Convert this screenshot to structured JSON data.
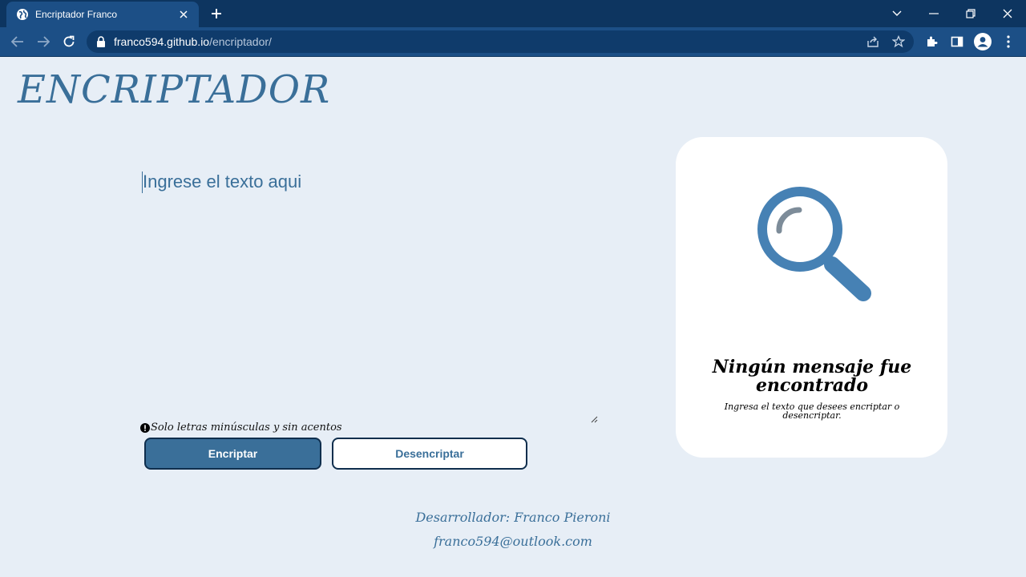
{
  "browser": {
    "tab_title": "Encriptador Franco",
    "url_host": "franco594.github.io",
    "url_path": "/encriptador/"
  },
  "page": {
    "logo": "ENCRIPTADOR",
    "input_placeholder": "Ingrese el texto aqui",
    "input_value": "",
    "hint": "Solo letras minúsculas y sin acentos",
    "encrypt_label": "Encriptar",
    "decrypt_label": "Desencriptar",
    "footer_developer": "Desarrollador: Franco Pieroni",
    "footer_email": "franco594@outlook.com"
  },
  "result_card": {
    "heading": "Ningún mensaje fue encontrado",
    "subtext": "Ingresa el texto que desees encriptar o desencriptar.",
    "icon": "magnifier-icon"
  },
  "colors": {
    "accent": "#3a6f99",
    "page_bg": "#e7eef6",
    "browser_frame": "#0d3560",
    "browser_toolbar": "#1c4f86"
  }
}
